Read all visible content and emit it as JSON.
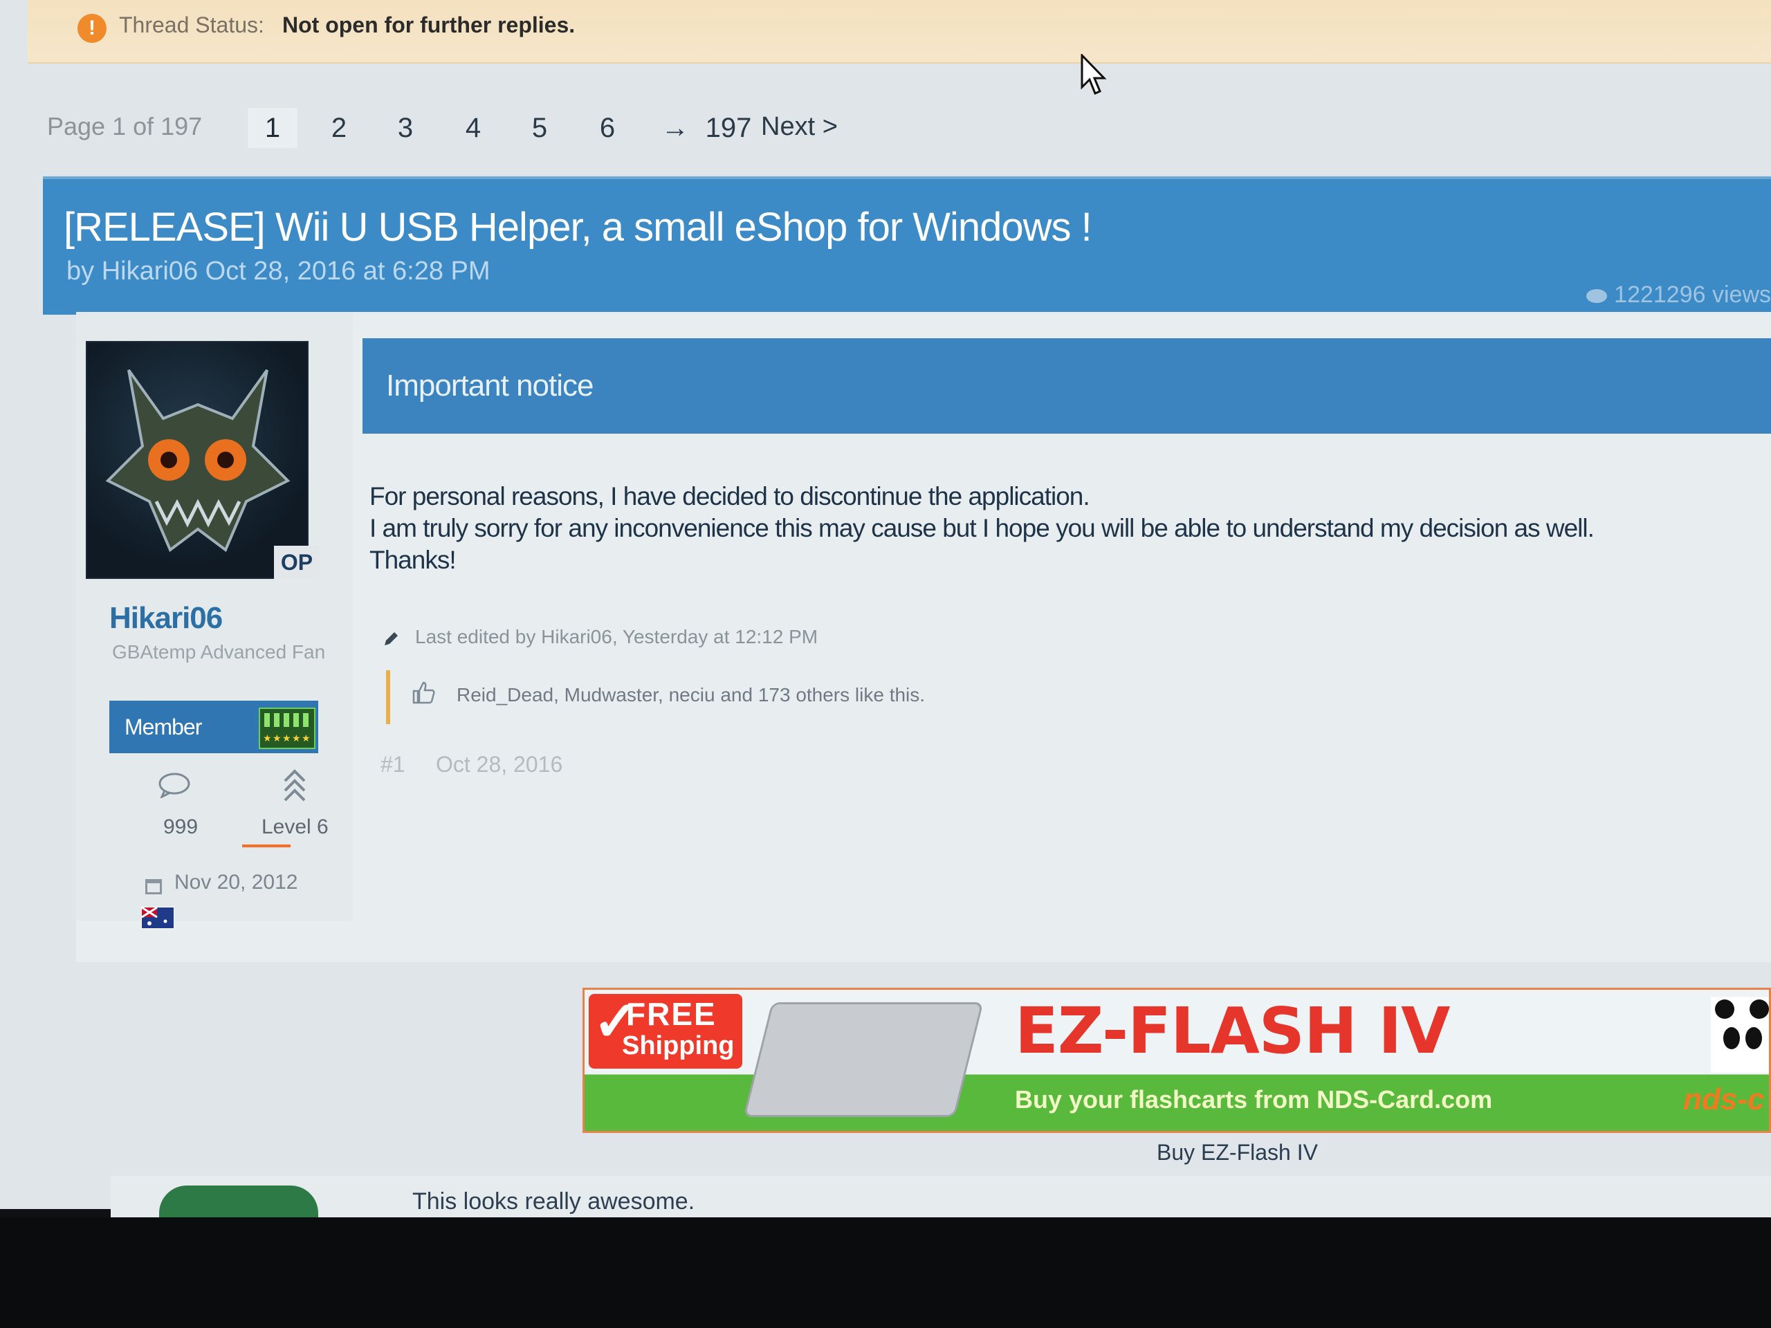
{
  "thread_status": {
    "label": "Thread Status:",
    "value": "Not open for further replies."
  },
  "pagination": {
    "page_info": "Page 1 of 197",
    "pages": [
      "1",
      "2",
      "3",
      "4",
      "5",
      "6"
    ],
    "current_page": "1",
    "ellipsis": "→",
    "last_page": "197",
    "next_label": "Next >"
  },
  "thread": {
    "title": "[RELEASE] Wii U USB Helper, a small eShop for Windows !",
    "meta": "by Hikari06 Oct 28, 2016 at 6:28 PM",
    "views": "1221296 views"
  },
  "author": {
    "username": "Hikari06",
    "title": "GBAtemp Advanced Fan",
    "op_badge": "OP",
    "role": "Member",
    "message_count": "999",
    "level": "Level 6",
    "join_date": "Nov 20, 2012"
  },
  "post": {
    "notice_title": "Important notice",
    "lines": [
      "For personal reasons, I have decided to discontinue the application.",
      "I am truly sorry for any inconvenience this may cause but I hope you will be able to understand my decision as well.",
      "Thanks!"
    ],
    "edited_note": "Last edited by Hikari06, Yesterday at 12:12 PM",
    "likes": "Reid_Dead, Mudwaster, neciu and 173 others like this.",
    "post_number": "#1",
    "post_date": "Oct 28, 2016"
  },
  "ad": {
    "badge_free": "FREE",
    "badge_shipping": "Shipping",
    "heading": "EZ-FLASH IV",
    "tagline": "Buy your flashcarts from NDS-Card.com",
    "brand": "nds-c",
    "caption": "Buy EZ-Flash IV"
  },
  "next_post": {
    "text": "This looks really awesome."
  },
  "colors": {
    "accent_blue": "#3d8bc6",
    "status_bg": "#f3e1bf",
    "ad_red": "#e6352a",
    "ad_green": "#58b93c"
  }
}
